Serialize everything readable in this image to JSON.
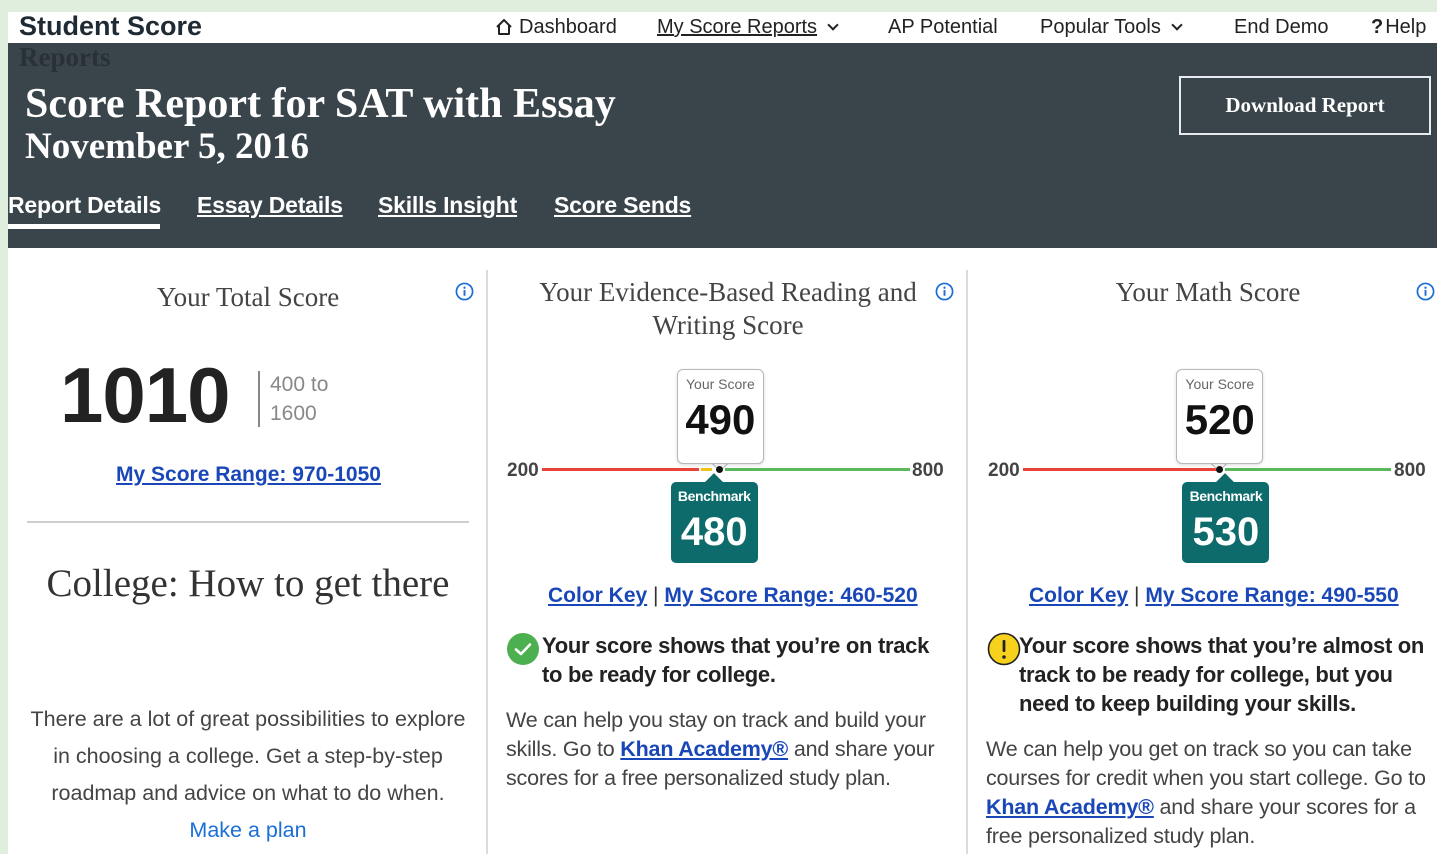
{
  "nav": {
    "brand_line1": "Student Score",
    "brand_line2": "Reports",
    "items": [
      {
        "label": "Dashboard"
      },
      {
        "label": "My Score Reports"
      },
      {
        "label": "AP Potential"
      },
      {
        "label": "Popular Tools"
      },
      {
        "label": "End Demo"
      },
      {
        "label": "Help"
      }
    ],
    "help_glyph": "?"
  },
  "header": {
    "title": "Score Report for SAT with Essay",
    "date": "November 5, 2016",
    "download_label": "Download Report",
    "tabs": [
      {
        "label": "Report Details"
      },
      {
        "label": "Essay Details"
      },
      {
        "label": "Skills Insight"
      },
      {
        "label": "Score Sends"
      }
    ]
  },
  "total": {
    "title": "Your Total Score",
    "score": "1010",
    "range_line1": "400 to",
    "range_line2": "1600",
    "range_link": "My Score Range: 970-1050"
  },
  "college": {
    "title": "College: How to get there",
    "text": "There are a lot of great possibilities to explore in choosing a college. Get a step-by-step roadmap and advice on what to do when.",
    "link": "Make a plan"
  },
  "ebrw": {
    "title": "Your Evidence-Based Reading and Writing Score",
    "score_caption": "Your Score",
    "score": "490",
    "benchmark_caption": "Benchmark",
    "benchmark": "480",
    "min": "200",
    "max": "800",
    "score_value": 490,
    "benchmark_value": 480,
    "color_key": "Color Key",
    "sep": "|",
    "range_link": "My Score Range: 460-520",
    "status": "Your score shows that you’re on track to be ready for college.",
    "help_before": "We can help you stay on track and build your skills. Go to ",
    "help_link": "Khan Academy®",
    "help_after": " and share your scores for a free personalized study plan."
  },
  "math": {
    "title": "Your Math Score",
    "score_caption": "Your Score",
    "score": "520",
    "benchmark_caption": "Benchmark",
    "benchmark": "530",
    "min": "200",
    "max": "800",
    "score_value": 520,
    "benchmark_value": 530,
    "color_key": "Color Key",
    "sep": "|",
    "range_link": "My Score Range: 490-550",
    "status": "Your score shows that you’re almost on track to be ready for college, but you need to keep building your skills.",
    "help_before": "We can help you get on track so you can take courses for credit when you start college. Go to ",
    "help_link": "Khan Academy®",
    "help_after": " and share your scores for a free personalized study plan."
  },
  "colors": {
    "header_bg": "#3a454b",
    "benchmark": "#0d6b6c",
    "below": "#e8423a",
    "near": "#f2c21a",
    "above": "#5cb85c",
    "link": "#1a47b8"
  }
}
